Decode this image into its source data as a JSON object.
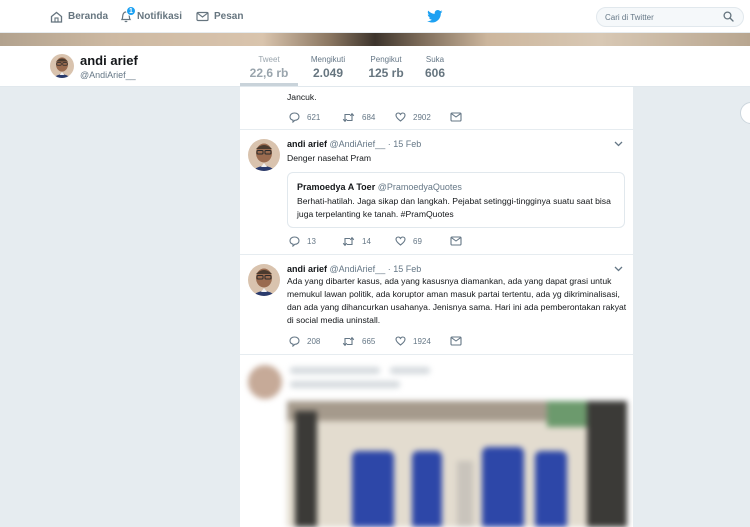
{
  "nav": {
    "home": "Beranda",
    "notifications": "Notifikasi",
    "notif_count": "1",
    "messages": "Pesan",
    "search_placeholder": "Cari di Twitter"
  },
  "profile": {
    "name": "andi arief",
    "handle": "@AndiArief__",
    "stats": [
      {
        "label": "Tweet",
        "value": "22,6 rb"
      },
      {
        "label": "Mengikuti",
        "value": "2.049"
      },
      {
        "label": "Pengikut",
        "value": "125 rb"
      },
      {
        "label": "Suka",
        "value": "606"
      }
    ]
  },
  "tweets": [
    {
      "text": "Jancuk.",
      "replies": "621",
      "retweets": "684",
      "likes": "2902"
    },
    {
      "name": "andi arief",
      "handle": "@AndiArief__",
      "date": "· 15 Feb",
      "text": "Denger nasehat Pram",
      "quote": {
        "name": "Pramoedya A Toer",
        "handle": "@PramoedyaQuotes",
        "text": "Berhati-hatilah. Jaga sikap dan langkah. Pejabat setinggi-tingginya suatu saat bisa juga terpelanting ke tanah. #PramQuotes"
      },
      "replies": "13",
      "retweets": "14",
      "likes": "69"
    },
    {
      "name": "andi arief",
      "handle": "@AndiArief__",
      "date": "· 15 Feb",
      "text": "Ada yang dibarter kasus, ada yang kasusnya diamankan, ada yang dapat grasi untuk memukul lawan politik, ada koruptor aman masuk partai tertentu, ada yg dikriminalisasi, dan ada yang dihancurkan usahanya. Jenisnya sama. Hari ini ada pemberontakan rakyat di social media uninstall.",
      "replies": "208",
      "retweets": "665",
      "likes": "1924"
    }
  ],
  "colors": {
    "twitter_blue": "#1da1f2",
    "text": "#14171a",
    "muted": "#657786",
    "background": "#e6ecf0"
  }
}
